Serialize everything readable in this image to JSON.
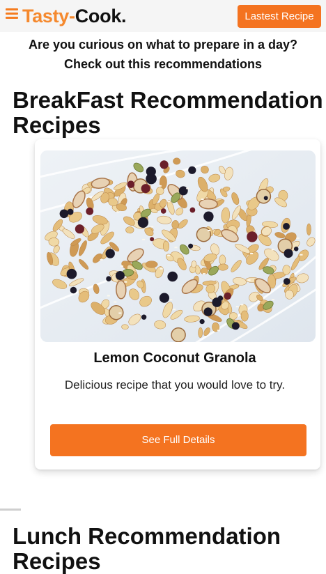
{
  "navbar": {
    "menu_icon": "hamburger-menu-icon",
    "brand_part_1": "Tasty-",
    "brand_part_2": "Cook.",
    "latest_button": "Lastest Recipe",
    "accent_color": "#f47320",
    "brand_orange": "#f5892e"
  },
  "intro": {
    "line1": "Are you curious on what to prepare in a day?",
    "line2": "Check out this recommendations"
  },
  "sections": {
    "breakfast": {
      "title_line1": "BreakFast Recommendation",
      "title_line2": "Recipes",
      "card": {
        "image": "granola-photo",
        "title": "Lemon Coconut Granola",
        "description": "Delicious recipe that you would love to try.",
        "button": "See Full Details"
      }
    },
    "lunch": {
      "title_line1": "Lunch Recommendation",
      "title_line2": "Recipes"
    }
  }
}
